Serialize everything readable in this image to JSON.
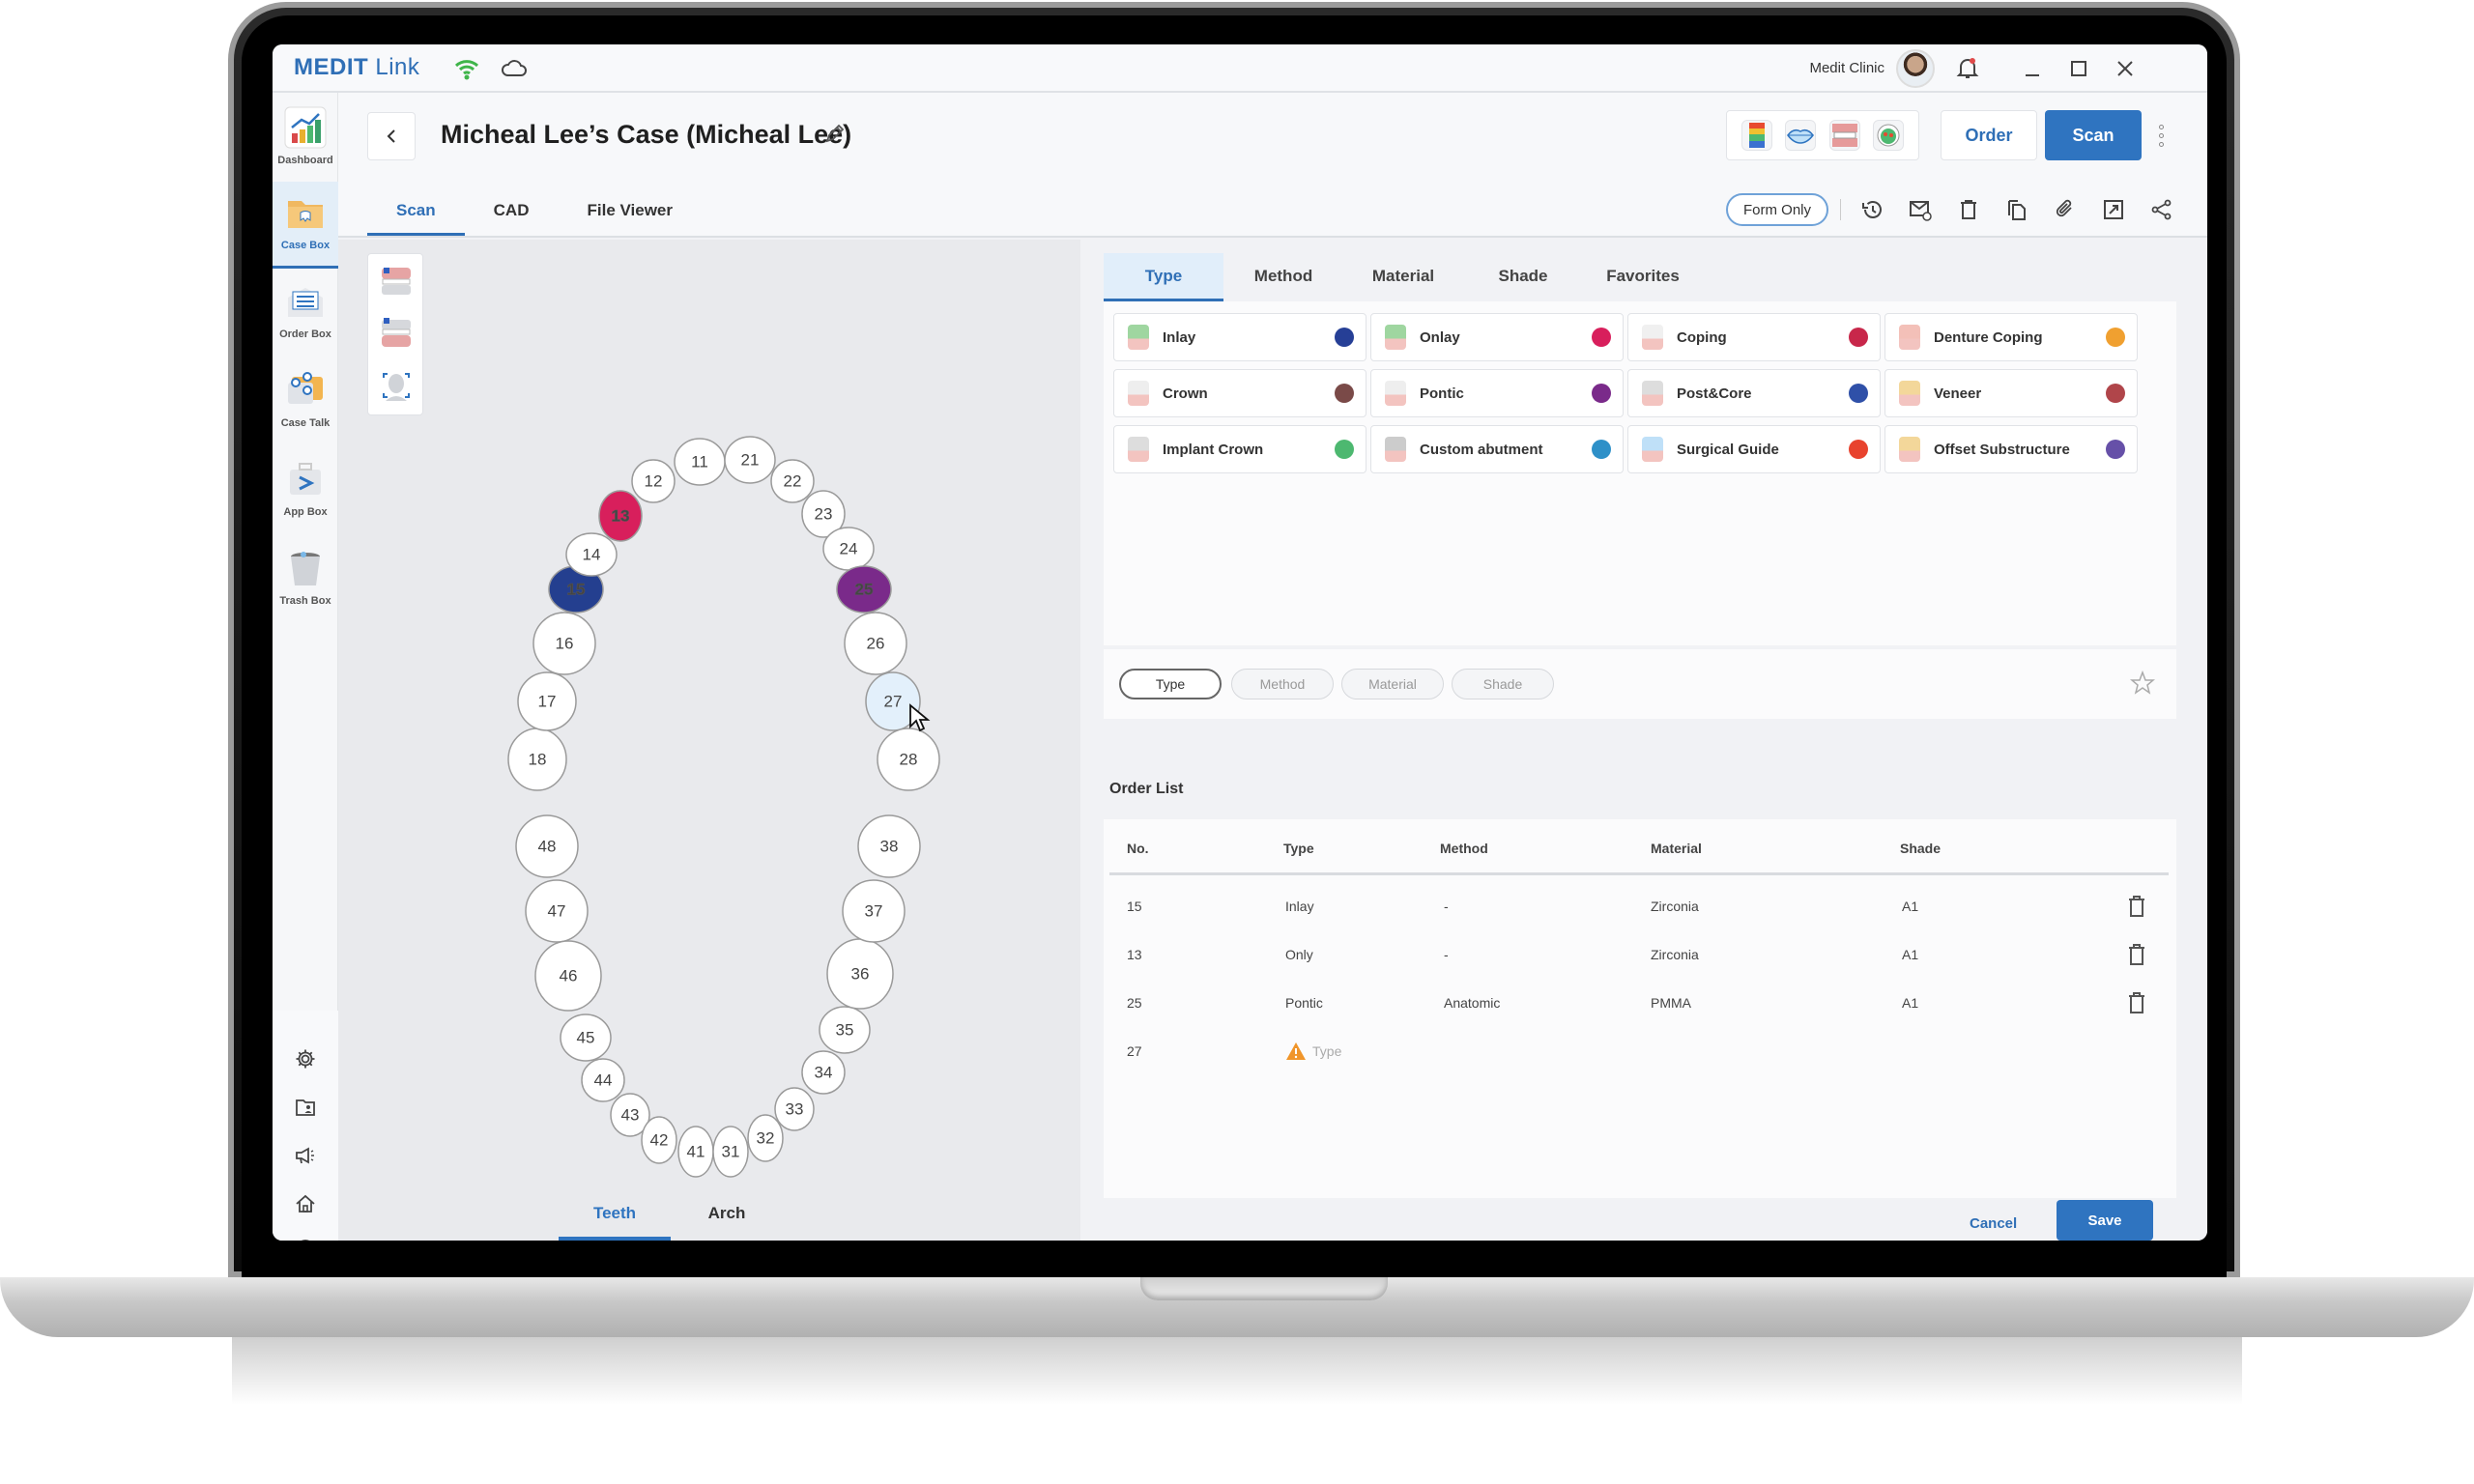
{
  "app": {
    "brand_bold": "MEDIT",
    "brand_light": " Link",
    "clinic_name": "Medit Clinic",
    "icons": [
      "wifi-icon",
      "cloud-icon",
      "bell-icon",
      "minimize-icon",
      "maximize-icon",
      "close-icon"
    ]
  },
  "sidebar": {
    "items": [
      {
        "label": "Dashboard",
        "icon": "dashboard-icon",
        "active": false
      },
      {
        "label": "Case Box",
        "icon": "case-box-icon",
        "active": true
      },
      {
        "label": "Order Box",
        "icon": "order-box-icon",
        "active": false
      },
      {
        "label": "Case Talk",
        "icon": "case-talk-icon",
        "active": false
      },
      {
        "label": "App Box",
        "icon": "app-box-icon",
        "active": false
      },
      {
        "label": "Trash Box",
        "icon": "trash-box-icon",
        "active": false
      }
    ],
    "bottom_icons": [
      "gear-icon",
      "folder-user-icon",
      "megaphone-icon",
      "home-icon",
      "info-icon"
    ]
  },
  "header": {
    "title": "Micheal Lee’s Case (Micheal Lee)",
    "tabs": [
      {
        "label": "Scan",
        "active": true
      },
      {
        "label": "CAD",
        "active": false
      },
      {
        "label": "File Viewer",
        "active": false
      }
    ],
    "quick_tools": [
      "tooth-color-map-icon",
      "lips-icon",
      "occlusion-icon",
      "mouth-scan-icon"
    ],
    "order_label": "Order",
    "scan_label": "Scan",
    "form_only_label": "Form Only",
    "toolbar_icons": [
      "history-icon",
      "mail-help-icon",
      "trash-icon",
      "copy-icon",
      "attach-icon",
      "export-icon",
      "share-icon"
    ]
  },
  "tooth_chart": {
    "view_tools": [
      "upper-jaw-icon",
      "lower-jaw-icon",
      "face-scan-icon"
    ],
    "selected": [
      {
        "tooth": "13",
        "color": "#d81f5c"
      },
      {
        "tooth": "15",
        "color": "#243f8f"
      },
      {
        "tooth": "25",
        "color": "#7a2a8a"
      }
    ],
    "hover": {
      "tooth": "27",
      "color": "#e3f0fb"
    },
    "upper": [
      "18",
      "17",
      "16",
      "15",
      "14",
      "13",
      "12",
      "11",
      "21",
      "22",
      "23",
      "24",
      "25",
      "26",
      "27",
      "28"
    ],
    "lower": [
      "48",
      "47",
      "46",
      "45",
      "44",
      "43",
      "42",
      "41",
      "31",
      "32",
      "33",
      "34",
      "35",
      "36",
      "37",
      "38"
    ],
    "bottom_tabs": [
      {
        "label": "Teeth",
        "active": true
      },
      {
        "label": "Arch",
        "active": false
      }
    ]
  },
  "right_panel": {
    "tabs": [
      {
        "label": "Type",
        "active": true
      },
      {
        "label": "Method",
        "active": false
      },
      {
        "label": "Material",
        "active": false
      },
      {
        "label": "Shade",
        "active": false
      },
      {
        "label": "Favorites",
        "active": false
      }
    ],
    "types": [
      {
        "label": "Inlay",
        "color": "#263f96"
      },
      {
        "label": "Onlay",
        "color": "#d81f5c"
      },
      {
        "label": "Coping",
        "color": "#c8274a"
      },
      {
        "label": "Denture Coping",
        "color": "#f0a030"
      },
      {
        "label": "Crown",
        "color": "#7a4a48"
      },
      {
        "label": "Pontic",
        "color": "#7a2a8a"
      },
      {
        "label": "Post&Core",
        "color": "#2f50a8"
      },
      {
        "label": "Veneer",
        "color": "#b0454a"
      },
      {
        "label": "Implant Crown",
        "color": "#4db870"
      },
      {
        "label": "Custom abutment",
        "color": "#2e90c8"
      },
      {
        "label": "Surgical Guide",
        "color": "#e8432e"
      },
      {
        "label": "Offset Substructure",
        "color": "#6650a8"
      }
    ],
    "filter_chips": [
      {
        "label": "Type",
        "active": true
      },
      {
        "label": "Method",
        "active": false
      },
      {
        "label": "Material",
        "active": false
      },
      {
        "label": "Shade",
        "active": false
      }
    ],
    "order_list": {
      "title": "Order List",
      "columns": [
        "No.",
        "Type",
        "Method",
        "Material",
        "Shade"
      ],
      "rows": [
        {
          "no": "15",
          "type": "Inlay",
          "method": "-",
          "material": "Zirconia",
          "shade": "A1",
          "deletable": true
        },
        {
          "no": "13",
          "type": "Only",
          "method": "-",
          "material": "Zirconia",
          "shade": "A1",
          "deletable": true
        },
        {
          "no": "25",
          "type": "Pontic",
          "method": "Anatomic",
          "material": "PMMA",
          "shade": "A1",
          "deletable": true
        },
        {
          "no": "27",
          "type_placeholder": "Type",
          "warning": true
        }
      ]
    },
    "cancel_label": "Cancel",
    "save_label": "Save"
  },
  "colors": {
    "accent": "#2f74c0",
    "warning": "#f0952a"
  }
}
